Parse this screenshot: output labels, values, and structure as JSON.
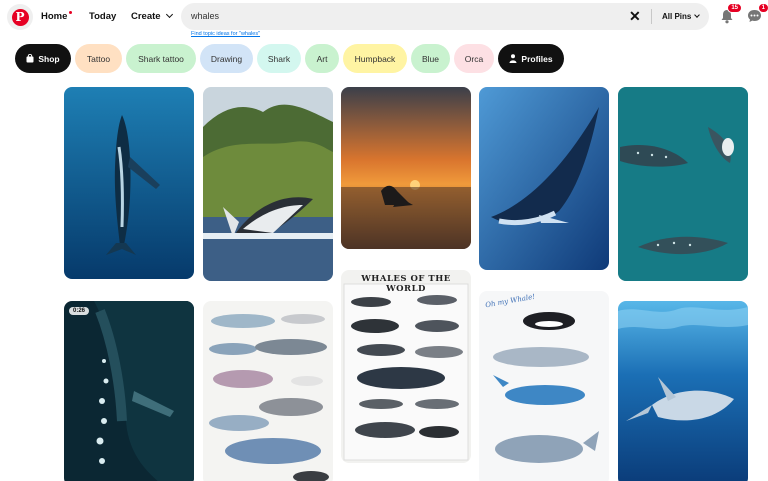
{
  "header": {
    "home_label": "Home",
    "today_label": "Today",
    "create_label": "Create",
    "search_value": "whales",
    "search_scope": "All Pins",
    "topic_link": "Find topic ideas for \"whales\"",
    "notifications_count": "15",
    "messages_count": "1",
    "logo_letter": "P",
    "icons": [
      "pinterest-logo",
      "close-icon",
      "chevron-down-icon",
      "bell-icon",
      "message-icon"
    ]
  },
  "chips": [
    {
      "label": "Shop",
      "color": "#111111",
      "icon": "bag-icon"
    },
    {
      "label": "Tattoo",
      "color": "#ffe0c2"
    },
    {
      "label": "Shark tattoo",
      "color": "#c9f2cf"
    },
    {
      "label": "Drawing",
      "color": "#d2e4f7"
    },
    {
      "label": "Shark",
      "color": "#d3f7ef"
    },
    {
      "label": "Art",
      "color": "#c9f2cf"
    },
    {
      "label": "Humpback",
      "color": "#fff4a3"
    },
    {
      "label": "Blue",
      "color": "#c9f2cf"
    },
    {
      "label": "Orca",
      "color": "#fde0e4"
    },
    {
      "label": "Profiles",
      "color": "#111111",
      "icon": "person-icon"
    }
  ],
  "pins": {
    "video_duration": "0:26",
    "poster_title": "WHALES OF THE WORLD",
    "poster_script_title": "Oh my Whale!"
  },
  "colors": {
    "brand": "#e60023",
    "link": "#0074e8",
    "search_bg": "#efefef"
  }
}
